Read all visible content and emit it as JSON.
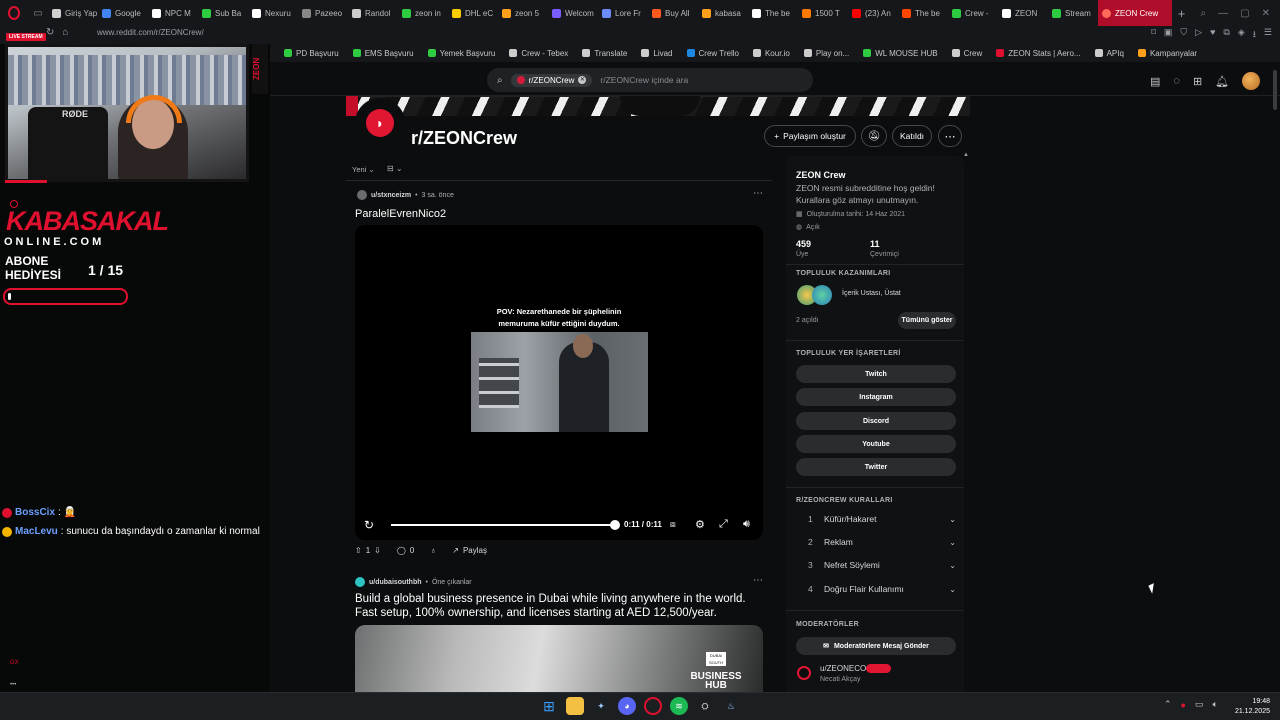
{
  "browser": {
    "tabs": [
      {
        "label": "Giriş Yap",
        "color": "#d0d0d0"
      },
      {
        "label": "Google",
        "color": "#4285f4"
      },
      {
        "label": "NPC M",
        "color": "#ffffff"
      },
      {
        "label": "Sub Ba",
        "color": "#2ecc40"
      },
      {
        "label": "Nexuru",
        "color": "#ffffff"
      },
      {
        "label": "Pazeeo",
        "color": "#888888"
      },
      {
        "label": "Randol",
        "color": "#cccccc"
      },
      {
        "label": "zeon in",
        "color": "#2ecc40"
      },
      {
        "label": "DHL eC",
        "color": "#ffcc00"
      },
      {
        "label": "zeon 5",
        "color": "#ff9f1a"
      },
      {
        "label": "Welcom",
        "color": "#7b5cff"
      },
      {
        "label": "Lore Fr",
        "color": "#6b8cff"
      },
      {
        "label": "Buy All",
        "color": "#ff5a1f"
      },
      {
        "label": "kabasa",
        "color": "#ff9f1a"
      },
      {
        "label": "The be",
        "color": "#ffffff"
      },
      {
        "label": "1500 T",
        "color": "#ff7a00"
      },
      {
        "label": "(23) An",
        "color": "#ff0000"
      },
      {
        "label": "The be",
        "color": "#ff4500"
      },
      {
        "label": "Crew -",
        "color": "#2ecc40"
      },
      {
        "label": "ZEON",
        "color": "#ffffff"
      },
      {
        "label": "Stream",
        "color": "#2ecc40"
      }
    ],
    "active_tab": "ZEON Crew",
    "url": "www.reddit.com/r/ZEONCrew/",
    "bookmarks": [
      {
        "label": "PD Başvuru",
        "color": "#2ecc40"
      },
      {
        "label": "EMS Başvuru",
        "color": "#2ecc40"
      },
      {
        "label": "Yemek Başvuru",
        "color": "#2ecc40"
      },
      {
        "label": "Crew - Tebex",
        "color": "#cccccc"
      },
      {
        "label": "Translate",
        "color": "#cccccc"
      },
      {
        "label": "Livad",
        "color": "#cccccc"
      },
      {
        "label": "Crew Trello",
        "color": "#1e88e5"
      },
      {
        "label": "Kour.io",
        "color": "#cccccc"
      },
      {
        "label": "Play on...",
        "color": "#cccccc"
      },
      {
        "label": "WL MOUSE HUB",
        "color": "#2ecc40"
      },
      {
        "label": "Crew",
        "color": "#cccccc"
      },
      {
        "label": "ZEON Stats | Aero...",
        "color": "#e0102f"
      },
      {
        "label": "APIq",
        "color": "#cccccc"
      },
      {
        "label": "Kampanyalar",
        "color": "#ff9f1a"
      }
    ]
  },
  "stream": {
    "live_badge": "LIVE STREAM",
    "vertical_logo": "ZEON",
    "chair_brand": "RØDE",
    "brand": "KABASAKAL",
    "brand_sub": "ONLINE.COM",
    "gift_label": "ABONE HEDİYESİ",
    "gift_count": "1 / 15",
    "gift_progress": 0.02,
    "chat": [
      {
        "user": "BossCix",
        "message": ":",
        "badge": "#e0102f"
      },
      {
        "user": "MacLevu",
        "message": ": sunucu da başındaydı o zamanlar ki normal",
        "badge": "#f5b400"
      }
    ],
    "chat_ghost_1": "GX",
    "chat_ghost_2": "•••"
  },
  "reddit": {
    "search_chip": "r/ZEONCrew",
    "search_placeholder": "r/ZEONCrew içinde ara",
    "community_name": "r/ZEONCrew",
    "create_post": "Paylaşım oluştur",
    "joined": "Katıldı",
    "sort": "Yeni",
    "post1": {
      "user": "u/stxnceizm",
      "time": "3 sa. önce",
      "title": "ParalelEvrenNico2",
      "caption_line1": "POV: Nezarethanede bir şüphelinin",
      "caption_line2": "memuruma küfür ettiğini duydum.",
      "time_display": "0:11 / 0:11",
      "upvotes": "1",
      "comments": "0",
      "share": "Paylaş"
    },
    "post2": {
      "user": "u/dubaisouthbh",
      "tag": "Öne çıkanlar",
      "title": "Build a global business presence in Dubai while living anywhere in the world. Fast setup, 100% ownership, and licenses starting at AED 12,500/year.",
      "image_text": "BUSINESS HUB",
      "image_small": "DUBAI SOUTH"
    },
    "sidebar": {
      "name": "ZEON Crew",
      "description": "ZEON resmi subredditine hoş geldin! Kurallara göz atmayı unutmayın.",
      "created": "Oluşturulma tarihi: 14 Haz 2021",
      "visibility": "Açık",
      "members": "459",
      "members_label": "Üye",
      "online": "11",
      "online_label": "Çevrimiçi",
      "achievements_head": "TOPLULUK KAZANIMLARI",
      "achievements_text": "İçerik Ustası, Üstat",
      "unlocked": "2 açıldı",
      "show_all": "Tümünü göster",
      "bookmarks_head": "TOPLULUK YER İŞARETLERİ",
      "links": [
        "Twitch",
        "Instagram",
        "Discord",
        "Youtube",
        "Twitter"
      ],
      "rules_head": "R/ZEONCREW KURALLARI",
      "rules": [
        {
          "n": "1",
          "text": "Küfür/Hakaret"
        },
        {
          "n": "2",
          "text": "Reklam"
        },
        {
          "n": "3",
          "text": "Nefret Söylemi"
        },
        {
          "n": "4",
          "text": "Doğru Flair Kullanımı"
        }
      ],
      "mods_head": "MODERATÖRLER",
      "message_mods": "Moderatörlere Mesaj Gönder",
      "mod_name": "u/ZEONECO",
      "mod_sub": "Necati Akçay"
    }
  },
  "taskbar": {
    "time": "19:48",
    "date": "21.12.2025"
  },
  "colors": {
    "accent": "#e0102f",
    "reddit_bg": "#0b0d0e"
  }
}
